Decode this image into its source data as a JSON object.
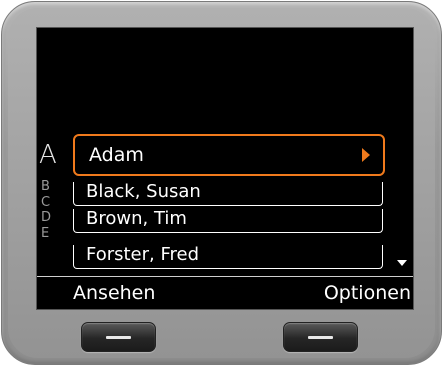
{
  "index": {
    "current": "A",
    "letters": [
      "B",
      "C",
      "D",
      "E"
    ]
  },
  "contacts": [
    {
      "name": "Adam",
      "selected": true
    },
    {
      "name": "Black, Susan",
      "selected": false
    },
    {
      "name": "Brown, Tim",
      "selected": false
    },
    {
      "name": "Forster, Fred",
      "selected": false
    }
  ],
  "softkeys": {
    "left": "Ansehen",
    "right": "Optionen"
  },
  "icons": {
    "selected_arrow": "chevron-right-icon",
    "scroll_indicator": "scroll-down-icon",
    "key_marker": "dash-icon"
  },
  "colors": {
    "accent": "#f07a1c",
    "screen_bg": "#000000",
    "text": "#ffffff",
    "index_dim": "#9a9a9a",
    "device_body": "#9a9a9a"
  }
}
